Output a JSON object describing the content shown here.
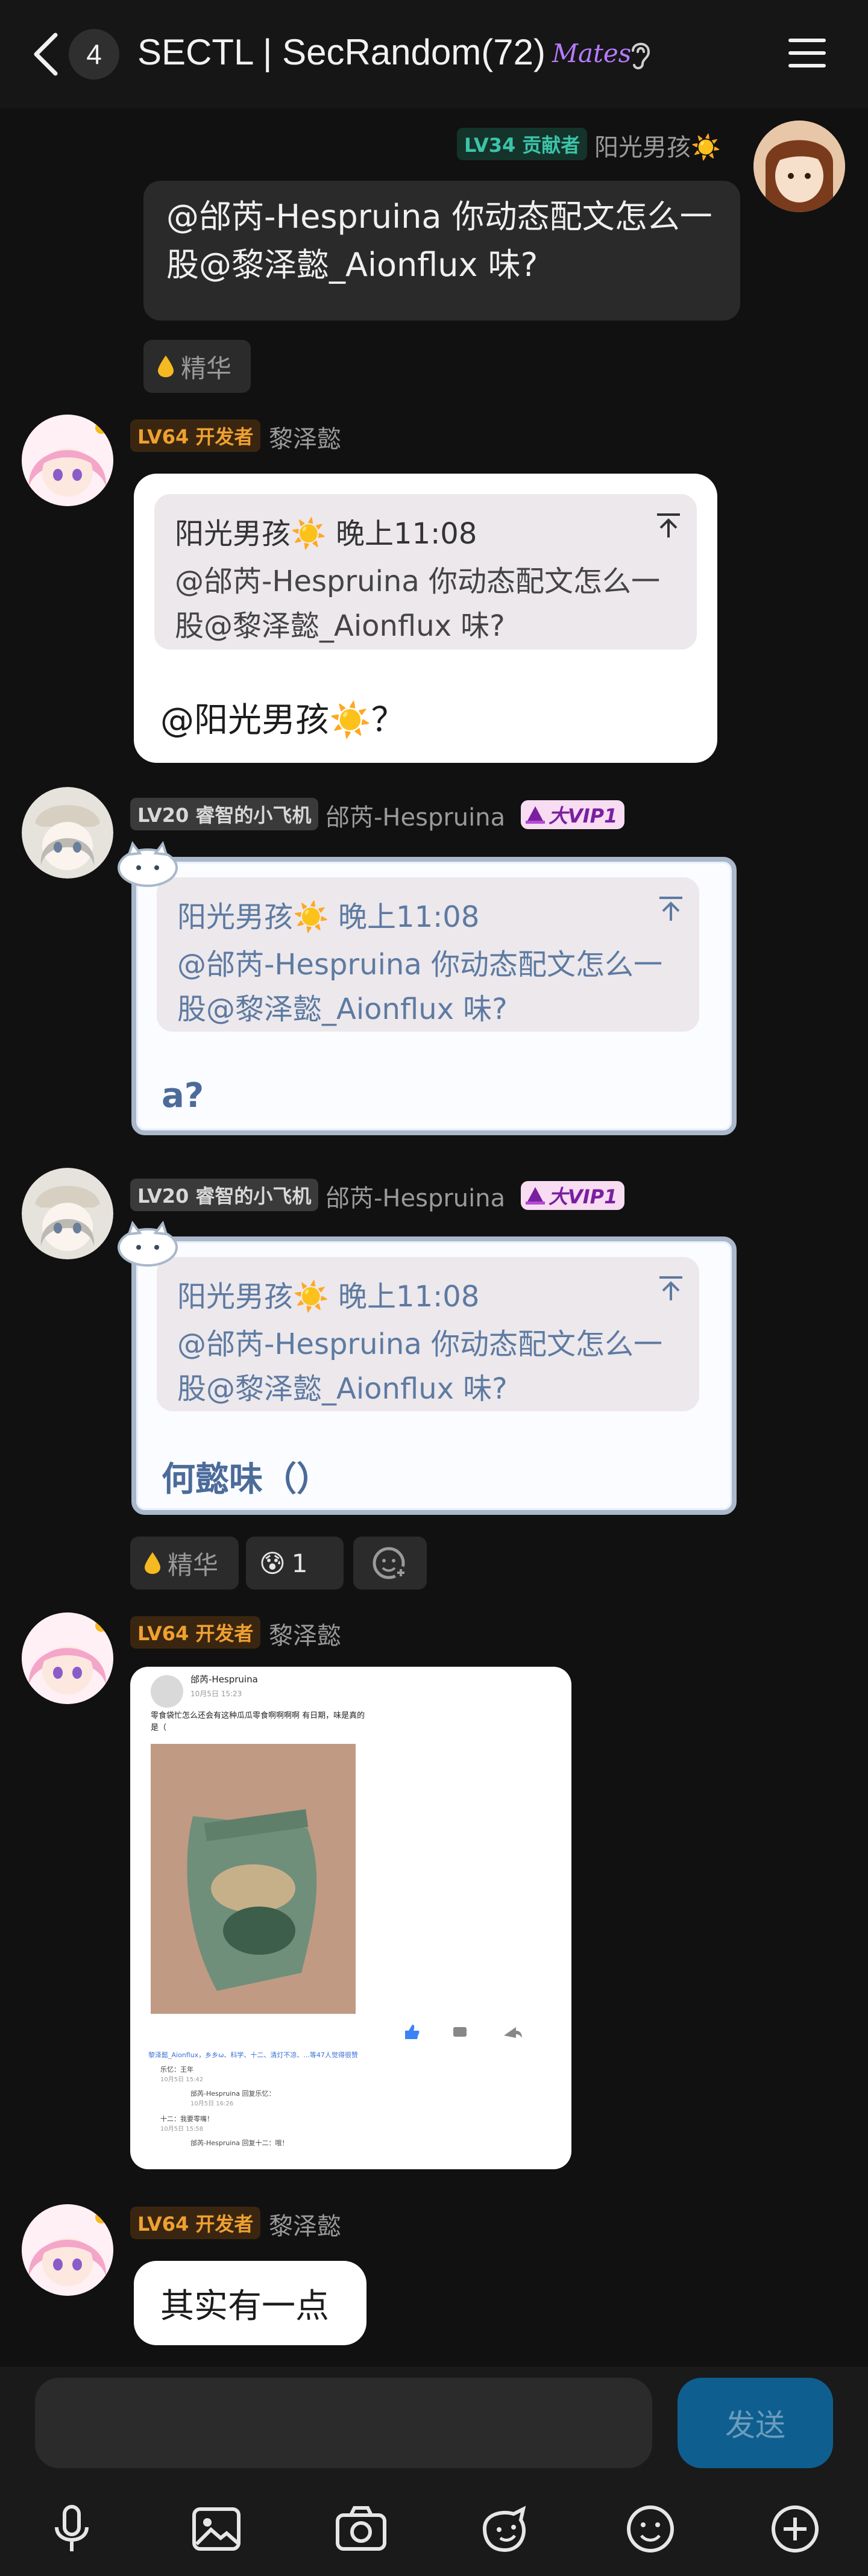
{
  "header": {
    "unread_count": "4",
    "title": "SECTL | SecRandom(72)",
    "mutual_badge": "Mates"
  },
  "messages": [
    {
      "level": "LV34 贡献者",
      "name": "阳光男孩☀️",
      "text": "@邰芮-Hespruina 你动态配文怎么一股@黎泽懿_Aionflux 味?",
      "essence": "精华"
    },
    {
      "level": "LV64 开发者",
      "name": "黎泽懿",
      "quote_head": "阳光男孩☀️ 晚上11:08",
      "quote_body": "@邰芮-Hespruina 你动态配文怎么一股@黎泽懿_Aionflux 味?",
      "text": "@阳光男孩☀️？"
    },
    {
      "level": "LV20 睿智的小飞机",
      "name": "邰芮-Hespruina",
      "vip": "大VIP1",
      "quote_head": "阳光男孩☀️ 晚上11:08",
      "quote_body": "@邰芮-Hespruina 你动态配文怎么一股@黎泽懿_Aionflux 味?",
      "text": "a?"
    },
    {
      "level": "LV20 睿智的小飞机",
      "name": "邰芮-Hespruina",
      "vip": "大VIP1",
      "quote_head": "阳光男孩☀️ 晚上11:08",
      "quote_body": "@邰芮-Hespruina 你动态配文怎么一股@黎泽懿_Aionflux 味?",
      "text": "何懿味（）",
      "essence": "精华",
      "reaction_emoji": "😰",
      "reaction_count": "1"
    },
    {
      "level": "LV64 开发者",
      "name": "黎泽懿",
      "image": {
        "author": "邰芮-Hespruina",
        "time": "10月5日 15:23",
        "caption": "零食袋忙怎么还会有这种瓜瓜零食啊啊啊啊 有日期，味是真的是（",
        "comment_1": "黎泽懿_Aionflux，乡乡ω、科学、十二、清灯不凉、...等47人觉得很赞",
        "comment_2_name": "乐忆：王年",
        "comment_2_time": "10月5日 15:42",
        "comment_3_name": "邰芮-Hespruina 回复乐忆：",
        "comment_3_time": "10月5日 16:26",
        "comment_4_name": "十二：我要零嘴！",
        "comment_4_time": "10月5日 15:58",
        "comment_5_name": "邰芮-Hespruina 回复十二：哦！"
      }
    },
    {
      "level": "LV64 开发者",
      "name": "黎泽懿",
      "text": "其实有一点"
    }
  ],
  "input": {
    "placeholder": "",
    "send_label": "发送"
  },
  "colors": {
    "background": "#111111",
    "contributor_badge": "#3cc3a8",
    "developer_badge": "#f0a030",
    "send_button": "#0e5f8f"
  }
}
